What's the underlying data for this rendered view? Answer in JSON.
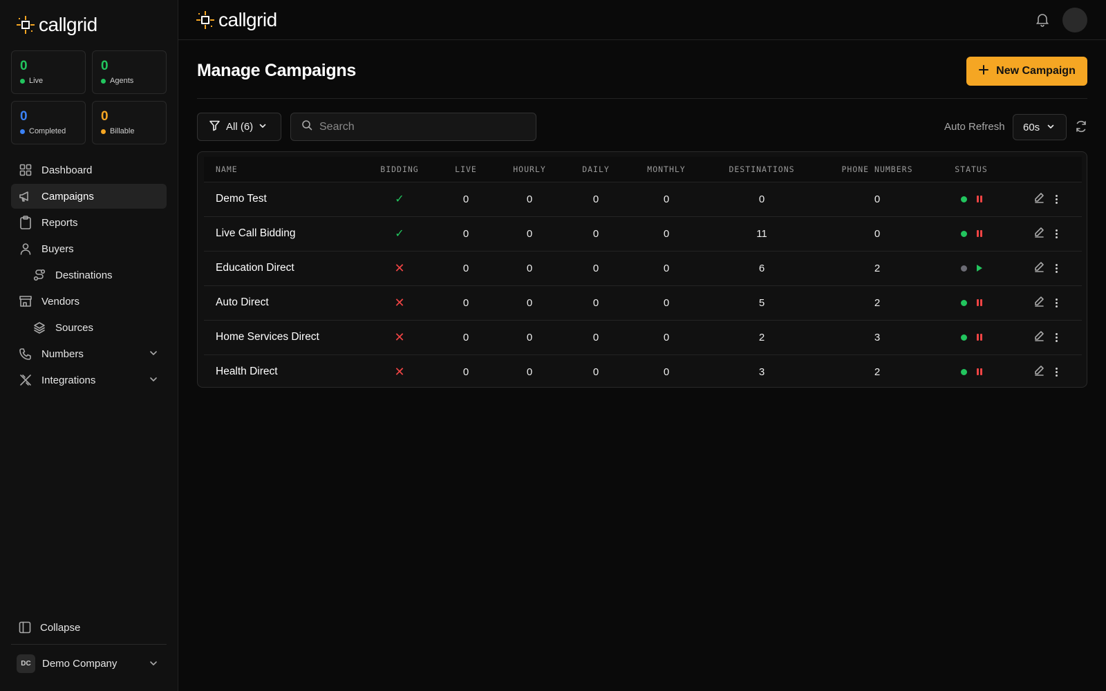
{
  "brand": {
    "name": "callgrid"
  },
  "stats": [
    {
      "value": "0",
      "label": "Live",
      "color": "#22c55e"
    },
    {
      "value": "0",
      "label": "Agents",
      "color": "#22c55e"
    },
    {
      "value": "0",
      "label": "Completed",
      "color": "#3b82f6"
    },
    {
      "value": "0",
      "label": "Billable",
      "color": "#f5a623"
    }
  ],
  "nav": {
    "items": [
      {
        "label": "Dashboard"
      },
      {
        "label": "Campaigns"
      },
      {
        "label": "Reports"
      },
      {
        "label": "Buyers"
      },
      {
        "label": "Destinations"
      },
      {
        "label": "Vendors"
      },
      {
        "label": "Sources"
      },
      {
        "label": "Numbers"
      },
      {
        "label": "Integrations"
      }
    ],
    "active": "Campaigns"
  },
  "sidebar_footer": {
    "collapse_label": "Collapse",
    "company_initials": "DC",
    "company_name": "Demo Company"
  },
  "page": {
    "title": "Manage Campaigns",
    "new_button_label": "New Campaign",
    "filter_label": "All (6)",
    "search_placeholder": "Search",
    "auto_refresh_label": "Auto Refresh",
    "auto_refresh_value": "60s"
  },
  "table": {
    "columns": [
      "NAME",
      "BIDDING",
      "LIVE",
      "HOURLY",
      "DAILY",
      "MONTHLY",
      "DESTINATIONS",
      "PHONE NUMBERS",
      "STATUS"
    ],
    "rows": [
      {
        "name": "Demo Test",
        "bidding": "✓",
        "live": "0",
        "hourly": "0",
        "daily": "0",
        "monthly": "0",
        "destinations": "0",
        "phone_numbers": "0",
        "status": "active"
      },
      {
        "name": "Live Call Bidding",
        "bidding": "✓",
        "live": "0",
        "hourly": "0",
        "daily": "0",
        "monthly": "0",
        "destinations": "11",
        "phone_numbers": "0",
        "status": "active"
      },
      {
        "name": "Education Direct",
        "bidding": "✕",
        "live": "0",
        "hourly": "0",
        "daily": "0",
        "monthly": "0",
        "destinations": "6",
        "phone_numbers": "2",
        "status": "paused"
      },
      {
        "name": "Auto Direct",
        "bidding": "✕",
        "live": "0",
        "hourly": "0",
        "daily": "0",
        "monthly": "0",
        "destinations": "5",
        "phone_numbers": "2",
        "status": "active"
      },
      {
        "name": "Home Services Direct",
        "bidding": "✕",
        "live": "0",
        "hourly": "0",
        "daily": "0",
        "monthly": "0",
        "destinations": "2",
        "phone_numbers": "3",
        "status": "active"
      },
      {
        "name": "Health Direct",
        "bidding": "✕",
        "live": "0",
        "hourly": "0",
        "daily": "0",
        "monthly": "0",
        "destinations": "3",
        "phone_numbers": "2",
        "status": "active"
      }
    ]
  },
  "colors": {
    "accent": "#f5a623",
    "active": "#22c55e",
    "paused": "#6b6b74",
    "danger": "#ef4444",
    "info": "#3b82f6"
  }
}
